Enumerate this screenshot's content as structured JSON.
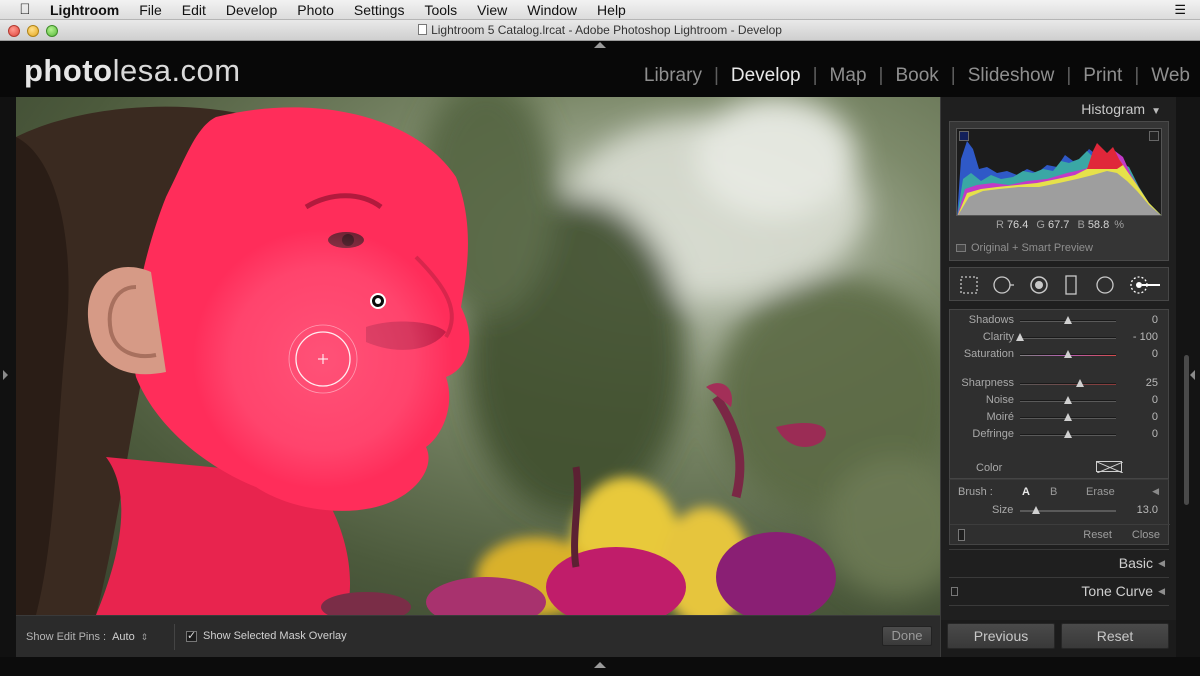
{
  "menubar": {
    "app": "Lightroom",
    "items": [
      "File",
      "Edit",
      "Develop",
      "Photo",
      "Settings",
      "Tools",
      "View",
      "Window",
      "Help"
    ]
  },
  "window": {
    "title": "Lightroom 5 Catalog.lrcat - Adobe Photoshop Lightroom - Develop"
  },
  "identity_plate": {
    "bold": "photo",
    "rest": "lesa.com"
  },
  "modules": [
    "Library",
    "Develop",
    "Map",
    "Book",
    "Slideshow",
    "Print",
    "Web"
  ],
  "active_module": "Develop",
  "histogram": {
    "title": "Histogram",
    "r_label": "R",
    "r_value": "76.4",
    "g_label": "G",
    "g_value": "67.7",
    "b_label": "B",
    "b_value": "58.8",
    "unit": "%",
    "preview_label": "Original + Smart Preview"
  },
  "tools": [
    "crop-overlay-tool",
    "spot-removal-tool",
    "red-eye-tool",
    "graduated-filter-tool",
    "radial-filter-tool",
    "adjustment-brush-tool"
  ],
  "adjustment_sliders": [
    {
      "label": "Shadows",
      "value": "0",
      "position": 0.5
    },
    {
      "label": "Clarity",
      "value": "- 100",
      "position": 0.0
    },
    {
      "label": "Saturation",
      "value": "0",
      "position": 0.5
    },
    {
      "label": "Sharpness",
      "value": "25",
      "position": 0.625
    },
    {
      "label": "Noise",
      "value": "0",
      "position": 0.5
    },
    {
      "label": "Moiré",
      "value": "0",
      "position": 0.5
    },
    {
      "label": "Defringe",
      "value": "0",
      "position": 0.5
    }
  ],
  "color_row": {
    "label": "Color"
  },
  "brush": {
    "label": "Brush :",
    "options": [
      "A",
      "B",
      "Erase"
    ],
    "selected": "A",
    "size_label": "Size",
    "size_value": "13.0",
    "size_position": 0.17,
    "reset": "Reset",
    "close": "Close"
  },
  "panels": [
    "Basic",
    "Tone Curve"
  ],
  "toolbar": {
    "show_edit_pins_label": "Show Edit Pins :",
    "show_edit_pins_value": "Auto",
    "show_mask_label": "Show Selected Mask Overlay",
    "show_mask_checked": true,
    "done_label": "Done"
  },
  "bottom_buttons": {
    "previous": "Previous",
    "reset": "Reset"
  },
  "colors": {
    "mask_overlay": "#ff2d5a",
    "panel_bg": "#2f2f2f",
    "active_module": "#e8e8e8"
  }
}
